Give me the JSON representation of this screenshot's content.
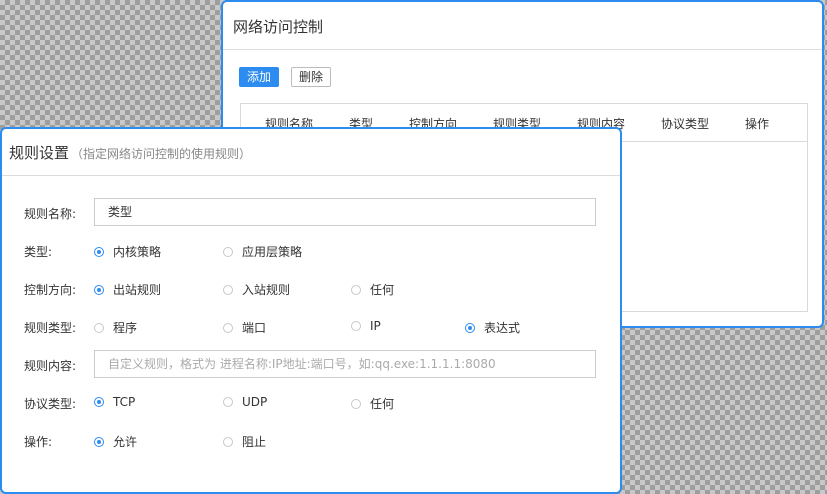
{
  "back_panel": {
    "title": "网络访问控制",
    "add_button": "添加",
    "delete_button": "删除",
    "table_headers": [
      "规则名称",
      "类型",
      "控制方向",
      "规则类型",
      "规则内容",
      "协议类型",
      "操作"
    ]
  },
  "front_panel": {
    "title": "规则设置",
    "subtitle": "（指定网络访问控制的使用规则）",
    "fields": {
      "name": {
        "label": "规则名称:",
        "value": "类型"
      },
      "type": {
        "label": "类型:",
        "options": [
          "内核策略",
          "应用层策略"
        ],
        "selected": 0
      },
      "direction": {
        "label": "控制方向:",
        "options": [
          "出站规则",
          "入站规则",
          "任何"
        ],
        "selected": 0
      },
      "rule_type": {
        "label": "规则类型:",
        "options": [
          "程序",
          "端口",
          "IP",
          "表达式"
        ],
        "selected": 3
      },
      "content": {
        "label": "规则内容:",
        "placeholder": "自定义规则，格式为 进程名称:IP地址:端口号，如:qq.exe:1.1.1.1:8080"
      },
      "protocol": {
        "label": "协议类型:",
        "options": [
          "TCP",
          "UDP",
          "任何"
        ],
        "selected": 0
      },
      "action": {
        "label": "操作:",
        "options": [
          "允许",
          "阻止"
        ],
        "selected": 0
      }
    }
  },
  "colors": {
    "accent": "#2d8cf0"
  }
}
